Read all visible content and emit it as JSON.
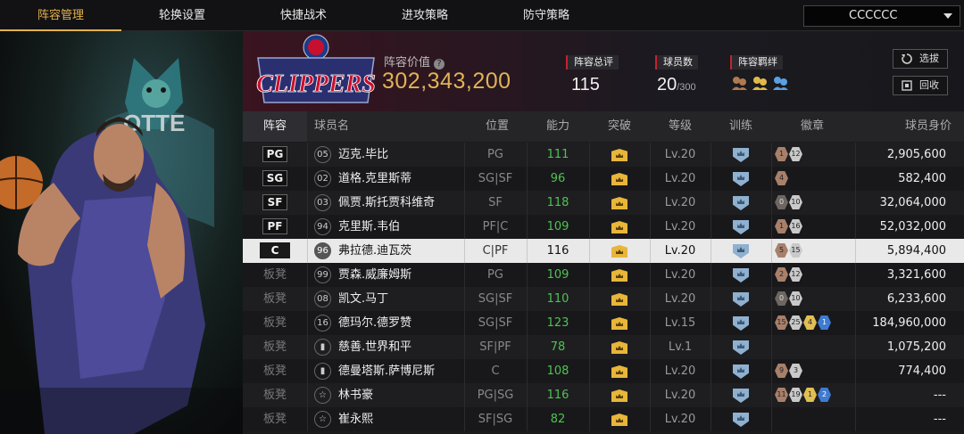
{
  "nav": {
    "tabs": [
      "阵容管理",
      "轮换设置",
      "快捷战术",
      "进攻策略",
      "防守策略"
    ],
    "active_index": 0,
    "account_name": "CCCCCC"
  },
  "art": {
    "jersey_text": "OTTE"
  },
  "header": {
    "team_logo_text": "CLIPPERS",
    "value_label": "阵容价值",
    "value": "302,343,200",
    "rating_label": "阵容总评",
    "rating_value": "115",
    "players_label": "球员数",
    "players_value": "20",
    "players_max": "/300",
    "bond_label": "阵容羁绊",
    "btn_select": "选拔",
    "btn_recycle": "回收"
  },
  "columns": [
    "阵容",
    "球员名",
    "位置",
    "能力",
    "突破",
    "等级",
    "训练",
    "徽章",
    "球员身价"
  ],
  "rows": [
    {
      "slot": "PG",
      "number": "05",
      "name": "迈克.毕比",
      "position": "PG",
      "power": "111",
      "level": "Lv.20",
      "badges": [
        [
          "1",
          "bronze"
        ],
        [
          "12",
          "silver"
        ]
      ],
      "price": "2,905,600",
      "selected": false,
      "bench": false
    },
    {
      "slot": "SG",
      "number": "02",
      "name": "道格.克里斯蒂",
      "position": "SG|SF",
      "power": "96",
      "level": "Lv.20",
      "badges": [
        [
          "4",
          "bronze"
        ]
      ],
      "price": "582,400",
      "selected": false,
      "bench": false
    },
    {
      "slot": "SF",
      "number": "03",
      "name": "佩贾.斯托贾科维奇",
      "position": "SF",
      "power": "118",
      "level": "Lv.20",
      "badges": [
        [
          "0",
          "dark"
        ],
        [
          "10",
          "silver"
        ]
      ],
      "price": "32,064,000",
      "selected": false,
      "bench": false
    },
    {
      "slot": "PF",
      "number": "94",
      "name": "克里斯.韦伯",
      "position": "PF|C",
      "power": "109",
      "level": "Lv.20",
      "badges": [
        [
          "1",
          "bronze"
        ],
        [
          "16",
          "silver"
        ]
      ],
      "price": "52,032,000",
      "selected": false,
      "bench": false
    },
    {
      "slot": "C",
      "number": "96",
      "name": "弗拉德.迪瓦茨",
      "position": "C|PF",
      "power": "116",
      "level": "Lv.20",
      "badges": [
        [
          "5",
          "bronze"
        ],
        [
          "15",
          "silver"
        ]
      ],
      "price": "5,894,400",
      "selected": true,
      "bench": false
    },
    {
      "slot": "板凳",
      "number": "99",
      "name": "贾森.威廉姆斯",
      "position": "PG",
      "power": "109",
      "level": "Lv.20",
      "badges": [
        [
          "2",
          "bronze"
        ],
        [
          "12",
          "silver"
        ]
      ],
      "price": "3,321,600",
      "selected": false,
      "bench": true
    },
    {
      "slot": "板凳",
      "number": "08",
      "name": "凯文.马丁",
      "position": "SG|SF",
      "power": "110",
      "level": "Lv.20",
      "badges": [
        [
          "0",
          "dark"
        ],
        [
          "10",
          "silver"
        ]
      ],
      "price": "6,233,600",
      "selected": false,
      "bench": true
    },
    {
      "slot": "板凳",
      "number": "16",
      "name": "德玛尔.德罗赞",
      "position": "SG|SF",
      "power": "123",
      "level": "Lv.15",
      "badges": [
        [
          "15",
          "bronze"
        ],
        [
          "25",
          "silver"
        ],
        [
          "4",
          "gold"
        ],
        [
          "1",
          "blue"
        ]
      ],
      "price": "184,960,000",
      "selected": false,
      "bench": true
    },
    {
      "slot": "板凳",
      "number": "",
      "name": "慈善.世界和平",
      "position": "SF|PF",
      "power": "78",
      "level": "Lv.1",
      "badges": [],
      "price": "1,075,200",
      "selected": false,
      "bench": true
    },
    {
      "slot": "板凳",
      "number": "",
      "name": "德曼塔斯.萨博尼斯",
      "position": "C",
      "power": "108",
      "level": "Lv.20",
      "badges": [
        [
          "9",
          "bronze"
        ],
        [
          "3",
          "silver"
        ]
      ],
      "price": "774,400",
      "selected": false,
      "bench": true
    },
    {
      "slot": "板凳",
      "number": "",
      "name": "林书豪",
      "position": "PG|SG",
      "power": "116",
      "level": "Lv.20",
      "badges": [
        [
          "11",
          "bronze"
        ],
        [
          "19",
          "silver"
        ],
        [
          "1",
          "gold"
        ],
        [
          "2",
          "blue"
        ]
      ],
      "price": "---",
      "selected": false,
      "bench": true
    },
    {
      "slot": "板凳",
      "number": "",
      "name": "崔永熙",
      "position": "SF|SG",
      "power": "82",
      "level": "Lv.20",
      "badges": [],
      "price": "---",
      "selected": false,
      "bench": true
    }
  ]
}
